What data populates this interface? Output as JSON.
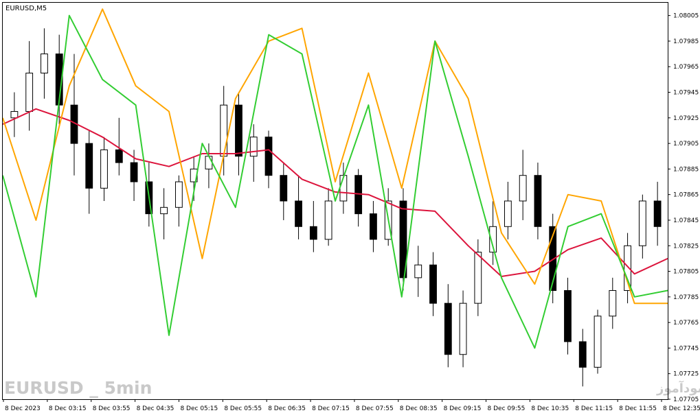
{
  "chart_data": {
    "type": "candlestick",
    "symbol_label": "EURUSD,M5",
    "watermark_left": "EURUSD _ 5min",
    "watermark_right": "انتشار در سایت سودآموز",
    "y_ticks": [
      "1.08005",
      "1.07985",
      "1.07965",
      "1.07945",
      "1.07925",
      "1.07905",
      "1.07885",
      "1.07865",
      "1.07845",
      "1.07825",
      "1.07805",
      "1.07785",
      "1.07765",
      "1.07745",
      "1.07725",
      "1.07705"
    ],
    "y_range": [
      1.07705,
      1.08015
    ],
    "x_ticks": [
      "8 Dec 2023",
      "8 Dec 03:15",
      "8 Dec 03:55",
      "8 Dec 04:35",
      "8 Dec 05:15",
      "8 Dec 05:55",
      "8 Dec 06:35",
      "8 Dec 07:15",
      "8 Dec 07:55",
      "8 Dec 08:35",
      "8 Dec 09:15",
      "8 Dec 09:55",
      "8 Dec 10:35",
      "8 Dec 11:15",
      "8 Dec 11:55",
      "8 Dec 12:35"
    ],
    "series": [
      {
        "role": "ma",
        "color": "#dc143c",
        "values": [
          1.0792,
          1.07932,
          1.07923,
          1.0791,
          1.07893,
          1.07887,
          1.07897,
          1.07897,
          1.079,
          1.07877,
          1.07867,
          1.07865,
          1.07854,
          1.07852,
          1.07825,
          1.07801,
          1.07805,
          1.07822,
          1.07831,
          1.07803,
          1.07815
        ]
      },
      {
        "role": "band-orange",
        "color": "#ffa500",
        "values": [
          1.07925,
          1.07845,
          1.0795,
          1.0801,
          1.0795,
          1.0793,
          1.07815,
          1.0794,
          1.07985,
          1.07995,
          1.07875,
          1.0796,
          1.0787,
          1.07985,
          1.0794,
          1.07835,
          1.07795,
          1.07865,
          1.0786,
          1.0778,
          1.0778
        ]
      },
      {
        "role": "band-green",
        "color": "#32cd32",
        "values": [
          1.0788,
          1.07785,
          1.08005,
          1.07955,
          1.07935,
          1.07755,
          1.07905,
          1.07855,
          1.0799,
          1.07975,
          1.0786,
          1.07935,
          1.07785,
          1.07985,
          1.07895,
          1.078,
          1.07745,
          1.0784,
          1.0785,
          1.07785,
          1.0779
        ]
      }
    ],
    "candles": [
      {
        "o": 1.07925,
        "h": 1.07945,
        "l": 1.0791,
        "c": 1.0793
      },
      {
        "o": 1.0793,
        "h": 1.07985,
        "l": 1.07915,
        "c": 1.0796
      },
      {
        "o": 1.0796,
        "h": 1.07995,
        "l": 1.0794,
        "c": 1.07975
      },
      {
        "o": 1.07975,
        "h": 1.0799,
        "l": 1.0792,
        "c": 1.07935
      },
      {
        "o": 1.07935,
        "h": 1.07975,
        "l": 1.0788,
        "c": 1.07905
      },
      {
        "o": 1.07905,
        "h": 1.07915,
        "l": 1.0785,
        "c": 1.0787
      },
      {
        "o": 1.0787,
        "h": 1.0791,
        "l": 1.0786,
        "c": 1.079
      },
      {
        "o": 1.079,
        "h": 1.07925,
        "l": 1.0788,
        "c": 1.0789
      },
      {
        "o": 1.0789,
        "h": 1.079,
        "l": 1.0786,
        "c": 1.07875
      },
      {
        "o": 1.07875,
        "h": 1.0789,
        "l": 1.0784,
        "c": 1.0785
      },
      {
        "o": 1.0785,
        "h": 1.0787,
        "l": 1.0783,
        "c": 1.07855
      },
      {
        "o": 1.07855,
        "h": 1.0788,
        "l": 1.0784,
        "c": 1.07875
      },
      {
        "o": 1.07875,
        "h": 1.07895,
        "l": 1.0786,
        "c": 1.07885
      },
      {
        "o": 1.07885,
        "h": 1.07905,
        "l": 1.0787,
        "c": 1.07895
      },
      {
        "o": 1.07895,
        "h": 1.0795,
        "l": 1.0788,
        "c": 1.07935
      },
      {
        "o": 1.07935,
        "h": 1.07945,
        "l": 1.0788,
        "c": 1.07895
      },
      {
        "o": 1.07895,
        "h": 1.0792,
        "l": 1.07875,
        "c": 1.0791
      },
      {
        "o": 1.0791,
        "h": 1.07915,
        "l": 1.0787,
        "c": 1.0788
      },
      {
        "o": 1.0788,
        "h": 1.0789,
        "l": 1.07845,
        "c": 1.0786
      },
      {
        "o": 1.0786,
        "h": 1.0788,
        "l": 1.0783,
        "c": 1.0784
      },
      {
        "o": 1.0784,
        "h": 1.0786,
        "l": 1.0782,
        "c": 1.0783
      },
      {
        "o": 1.0783,
        "h": 1.0787,
        "l": 1.07825,
        "c": 1.0786
      },
      {
        "o": 1.0786,
        "h": 1.0789,
        "l": 1.0785,
        "c": 1.0788
      },
      {
        "o": 1.0788,
        "h": 1.07885,
        "l": 1.0784,
        "c": 1.0785
      },
      {
        "o": 1.0785,
        "h": 1.0786,
        "l": 1.0782,
        "c": 1.0783
      },
      {
        "o": 1.0783,
        "h": 1.0787,
        "l": 1.07825,
        "c": 1.0786
      },
      {
        "o": 1.0786,
        "h": 1.0787,
        "l": 1.0779,
        "c": 1.078
      },
      {
        "o": 1.078,
        "h": 1.07825,
        "l": 1.07785,
        "c": 1.0781
      },
      {
        "o": 1.0781,
        "h": 1.0782,
        "l": 1.0777,
        "c": 1.0778
      },
      {
        "o": 1.0778,
        "h": 1.07795,
        "l": 1.0773,
        "c": 1.0774
      },
      {
        "o": 1.0774,
        "h": 1.0779,
        "l": 1.0773,
        "c": 1.0778
      },
      {
        "o": 1.0778,
        "h": 1.0783,
        "l": 1.0777,
        "c": 1.0782
      },
      {
        "o": 1.0782,
        "h": 1.0786,
        "l": 1.0781,
        "c": 1.0784
      },
      {
        "o": 1.0784,
        "h": 1.07875,
        "l": 1.0783,
        "c": 1.0786
      },
      {
        "o": 1.0786,
        "h": 1.079,
        "l": 1.07845,
        "c": 1.0788
      },
      {
        "o": 1.0788,
        "h": 1.0789,
        "l": 1.0783,
        "c": 1.0784
      },
      {
        "o": 1.0784,
        "h": 1.0785,
        "l": 1.0778,
        "c": 1.0779
      },
      {
        "o": 1.0779,
        "h": 1.078,
        "l": 1.0774,
        "c": 1.0775
      },
      {
        "o": 1.0775,
        "h": 1.0776,
        "l": 1.07715,
        "c": 1.0773
      },
      {
        "o": 1.0773,
        "h": 1.07775,
        "l": 1.07725,
        "c": 1.0777
      },
      {
        "o": 1.0777,
        "h": 1.078,
        "l": 1.0776,
        "c": 1.0779
      },
      {
        "o": 1.0779,
        "h": 1.07835,
        "l": 1.0778,
        "c": 1.07825
      },
      {
        "o": 1.07825,
        "h": 1.07865,
        "l": 1.07815,
        "c": 1.0786
      },
      {
        "o": 1.0786,
        "h": 1.07875,
        "l": 1.07825,
        "c": 1.0784
      }
    ]
  }
}
